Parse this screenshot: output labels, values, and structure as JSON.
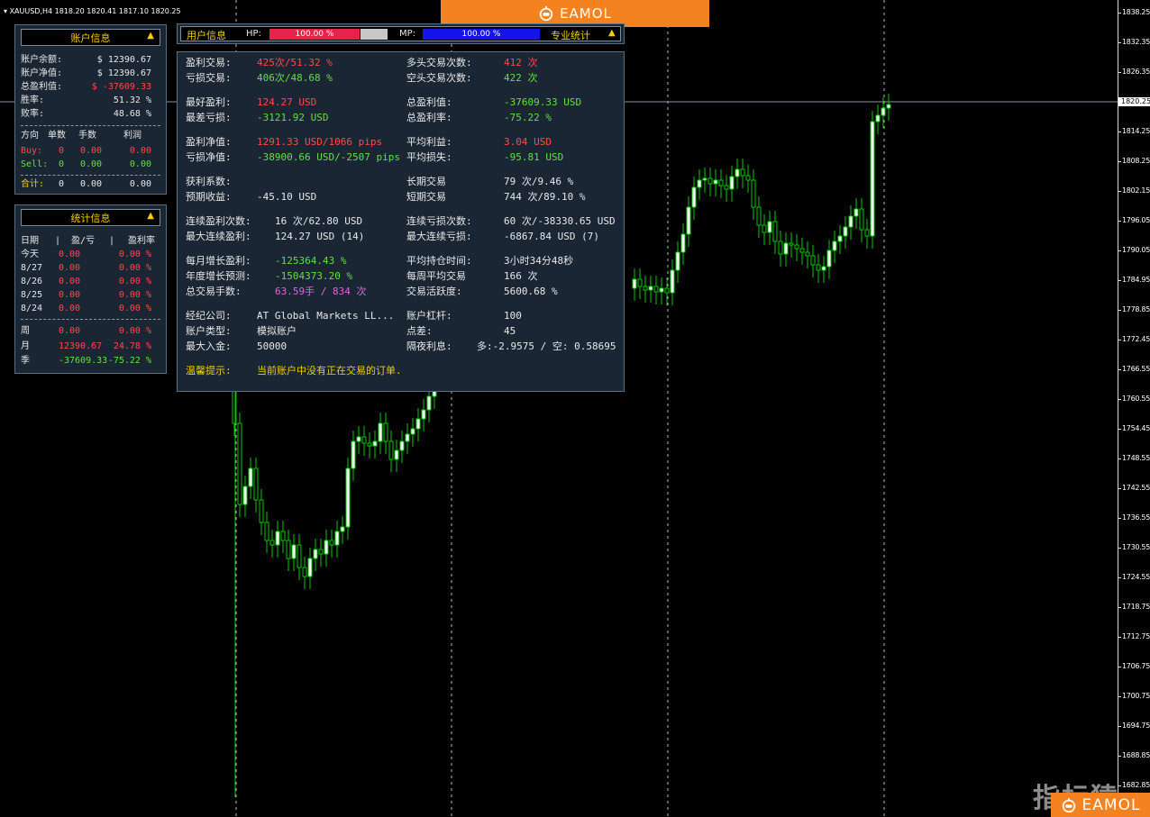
{
  "symbol_bar": "XAUUSD,H4  1818.20 1820.41 1817.10 1820.25",
  "brand": "EAMOL",
  "watermark": "指标猿",
  "price_axis": {
    "labels": [
      "1838.25",
      "1832.35",
      "1826.35",
      "1814.25",
      "1808.25",
      "1802.15",
      "1796.05",
      "1790.05",
      "1784.95",
      "1778.85",
      "1772.45",
      "1766.55",
      "1760.55",
      "1754.45",
      "1748.55",
      "1742.55",
      "1736.55",
      "1730.55",
      "1724.55",
      "1718.75",
      "1712.75",
      "1706.75",
      "1700.75",
      "1694.75",
      "1688.85",
      "1682.85"
    ],
    "current": "1820.25"
  },
  "account_panel": {
    "title": "账户信息",
    "rows": [
      {
        "label": "账户余额:",
        "value": "$ 12390.67"
      },
      {
        "label": "账户净值:",
        "value": "$ 12390.67"
      },
      {
        "label": "总盈利值:",
        "value": "$ -37609.33"
      },
      {
        "label": "胜率:",
        "value": "51.32 %"
      },
      {
        "label": "败率:",
        "value": "48.68 %"
      }
    ],
    "table_header": {
      "dir": "方向",
      "count": "单数",
      "lots": "手数",
      "profit": "利润"
    },
    "buy": {
      "dir": "Buy:",
      "count": "0",
      "lots": "0.00",
      "profit": "0.00"
    },
    "sell": {
      "dir": "Sell:",
      "count": "0",
      "lots": "0.00",
      "profit": "0.00"
    },
    "total": {
      "dir": "合计:",
      "count": "0",
      "lots": "0.00",
      "profit": "0.00"
    }
  },
  "stats_panel": {
    "title": "统计信息",
    "header": {
      "date": "日期",
      "pl": "盈/亏",
      "rate": "盈利率"
    },
    "rows": [
      {
        "date": "今天",
        "pl": "0.00",
        "rate": "0.00 %"
      },
      {
        "date": "8/27",
        "pl": "0.00",
        "rate": "0.00 %"
      },
      {
        "date": "8/26",
        "pl": "0.00",
        "rate": "0.00 %"
      },
      {
        "date": "8/25",
        "pl": "0.00",
        "rate": "0.00 %"
      },
      {
        "date": "8/24",
        "pl": "0.00",
        "rate": "0.00 %"
      }
    ],
    "week": {
      "date": "周",
      "pl": "0.00",
      "rate": "0.00 %"
    },
    "month": {
      "date": "月",
      "pl": "12390.67",
      "rate": "24.78 %"
    },
    "season": {
      "date": "季",
      "pl": "-37609.33",
      "rate": "-75.22 %"
    }
  },
  "top_strip": {
    "user_info": "用户信息",
    "hp_label": "HP:",
    "hp_value": "100.00 %",
    "mp_label": "MP:",
    "mp_value": "100.00 %",
    "pro_stats": "专业统计"
  },
  "main_panel": {
    "profit_trades_l": "盈利交易:",
    "profit_trades_v": "425次/51.32 %",
    "long_trades_l": "多头交易次数:",
    "long_trades_v": "412 次",
    "loss_trades_l": "亏损交易:",
    "loss_trades_v": "406次/48.68 %",
    "short_trades_l": "空头交易次数:",
    "short_trades_v": "422 次",
    "best_l": "最好盈利:",
    "best_v": "124.27 USD",
    "total_profit_l": "总盈利值:",
    "total_profit_v": "-37609.33 USD",
    "worst_l": "最差亏损:",
    "worst_v": "-3121.92 USD",
    "total_rate_l": "总盈利率:",
    "total_rate_v": "-75.22 %",
    "net_profit_l": "盈利净值:",
    "net_profit_v": "1291.33 USD/1066 pips",
    "avg_profit_l": "平均利益:",
    "avg_profit_v": "3.04 USD",
    "net_loss_l": "亏损净值:",
    "net_loss_v": "-38900.66 USD/-2507 pips",
    "avg_loss_l": "平均损失:",
    "avg_loss_v": "-95.81 USD",
    "pf_l": "获利系数:",
    "pf_v": "",
    "long_term_l": "长期交易",
    "long_term_v": "79 次/9.46 %",
    "expect_l": "预期收益:",
    "expect_v": "-45.10 USD",
    "short_term_l": "短期交易",
    "short_term_v": "744 次/89.10 %",
    "cons_win_l": "连续盈利次数:",
    "cons_win_v": "16 次/62.80 USD",
    "cons_loss_l": "连续亏损次数:",
    "cons_loss_v": "60 次/-38330.65 USD",
    "max_cons_win_l": "最大连续盈利:",
    "max_cons_win_v": "124.27 USD (14)",
    "max_cons_loss_l": "最大连续亏损:",
    "max_cons_loss_v": "-6867.84 USD (7)",
    "monthly_growth_l": "每月增长盈利:",
    "monthly_growth_v": "-125364.43 %",
    "avg_hold_l": "平均持仓时间:",
    "avg_hold_v": "3小时34分48秒",
    "yearly_forecast_l": "年度增长预测:",
    "yearly_forecast_v": "-1504373.20 %",
    "weekly_avg_l": "每周平均交易",
    "weekly_avg_v": "166 次",
    "total_lots_l": "总交易手数:",
    "total_lots_v": "63.59手 / 834 次",
    "activity_l": "交易活跃度:",
    "activity_v": "5600.68 %",
    "broker_l": "经纪公司:",
    "broker_v": "AT Global Markets LL...",
    "leverage_l": "账户杠杆:",
    "leverage_v": "100",
    "acct_type_l": "账户类型:",
    "acct_type_v": "模拟账户",
    "spread_l": "点差:",
    "spread_v": "45",
    "max_deposit_l": "最大入金:",
    "max_deposit_v": "50000",
    "swap_l": "隔夜利息:",
    "swap_v": "多:-2.9575 / 空: 0.58695",
    "tip_l": "温馨提示:",
    "tip_v": "当前账户中没有正在交易的订单."
  },
  "colors": {
    "bull": "#ffffff",
    "bear": "#00c800",
    "wick": "#00c800",
    "panel_bg": "#1b2634",
    "accent": "#f58220"
  }
}
